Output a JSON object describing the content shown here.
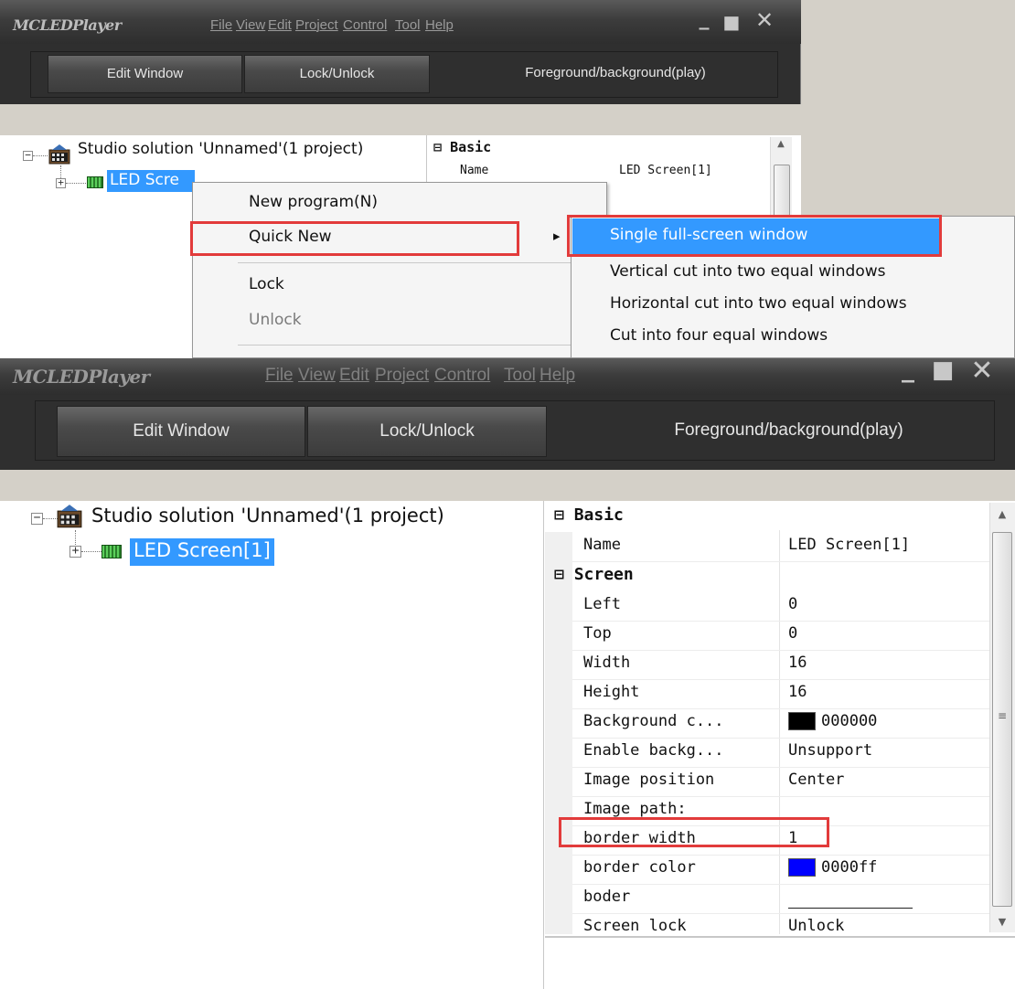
{
  "top": {
    "app_title": "MCLEDPlayer",
    "menu": [
      "File",
      "View",
      "Edit",
      "Project",
      "Control",
      "Tool",
      "Help"
    ],
    "window_controls": {
      "minimize": "_",
      "maximize": "■",
      "close": "✕"
    },
    "toolbar": [
      "Edit Window",
      "Lock/Unlock",
      "Foreground/background(play)"
    ],
    "tree": {
      "root": "Studio solution 'Unnamed'(1 project)",
      "child": "LED Scre"
    },
    "props": {
      "category": "Basic",
      "name_key": "Name",
      "name_val": "LED Screen[1]"
    },
    "context_menu": {
      "items": [
        "New program(N)",
        "Quick New",
        "Lock",
        "Unlock"
      ],
      "submenu_arrow": "▸"
    },
    "submenu": {
      "items": [
        "Single full-screen window",
        "Vertical cut into two equal windows",
        "Horizontal cut into two equal windows",
        "Cut into four equal windows"
      ]
    }
  },
  "bottom": {
    "app_title": "MCLEDPlayer",
    "menu": [
      "File",
      "View",
      "Edit",
      "Project",
      "Control",
      "Tool",
      "Help"
    ],
    "window_controls": {
      "minimize": "_",
      "maximize": "■",
      "close": "✕"
    },
    "toolbar": [
      "Edit Window",
      "Lock/Unlock",
      "Foreground/background(play)"
    ],
    "tree": {
      "root": "Studio solution 'Unnamed'(1 project)",
      "child": "LED Screen[1]"
    },
    "props": {
      "categories": {
        "basic": "Basic",
        "screen": "Screen"
      },
      "expand_sign": "⊟",
      "rows": [
        {
          "key": "Name",
          "value": "LED Screen[1]"
        },
        {
          "key": "Left",
          "value": "0"
        },
        {
          "key": "Top",
          "value": "0"
        },
        {
          "key": "Width",
          "value": "16"
        },
        {
          "key": "Height",
          "value": "16"
        },
        {
          "key": "Background c...",
          "value": "000000",
          "swatch": "#000000"
        },
        {
          "key": "Enable backg...",
          "value": "Unsupport"
        },
        {
          "key": "Image position",
          "value": "Center"
        },
        {
          "key": "Image path:",
          "value": ""
        },
        {
          "key": "border width",
          "value": "1"
        },
        {
          "key": "border color",
          "value": "0000ff",
          "swatch": "#0000ff"
        },
        {
          "key": "boder",
          "value": ""
        },
        {
          "key": "Screen lock",
          "value": "Unlock"
        }
      ]
    }
  },
  "colors": {
    "highlight": "#e23b3b",
    "selection": "#3399ff"
  }
}
